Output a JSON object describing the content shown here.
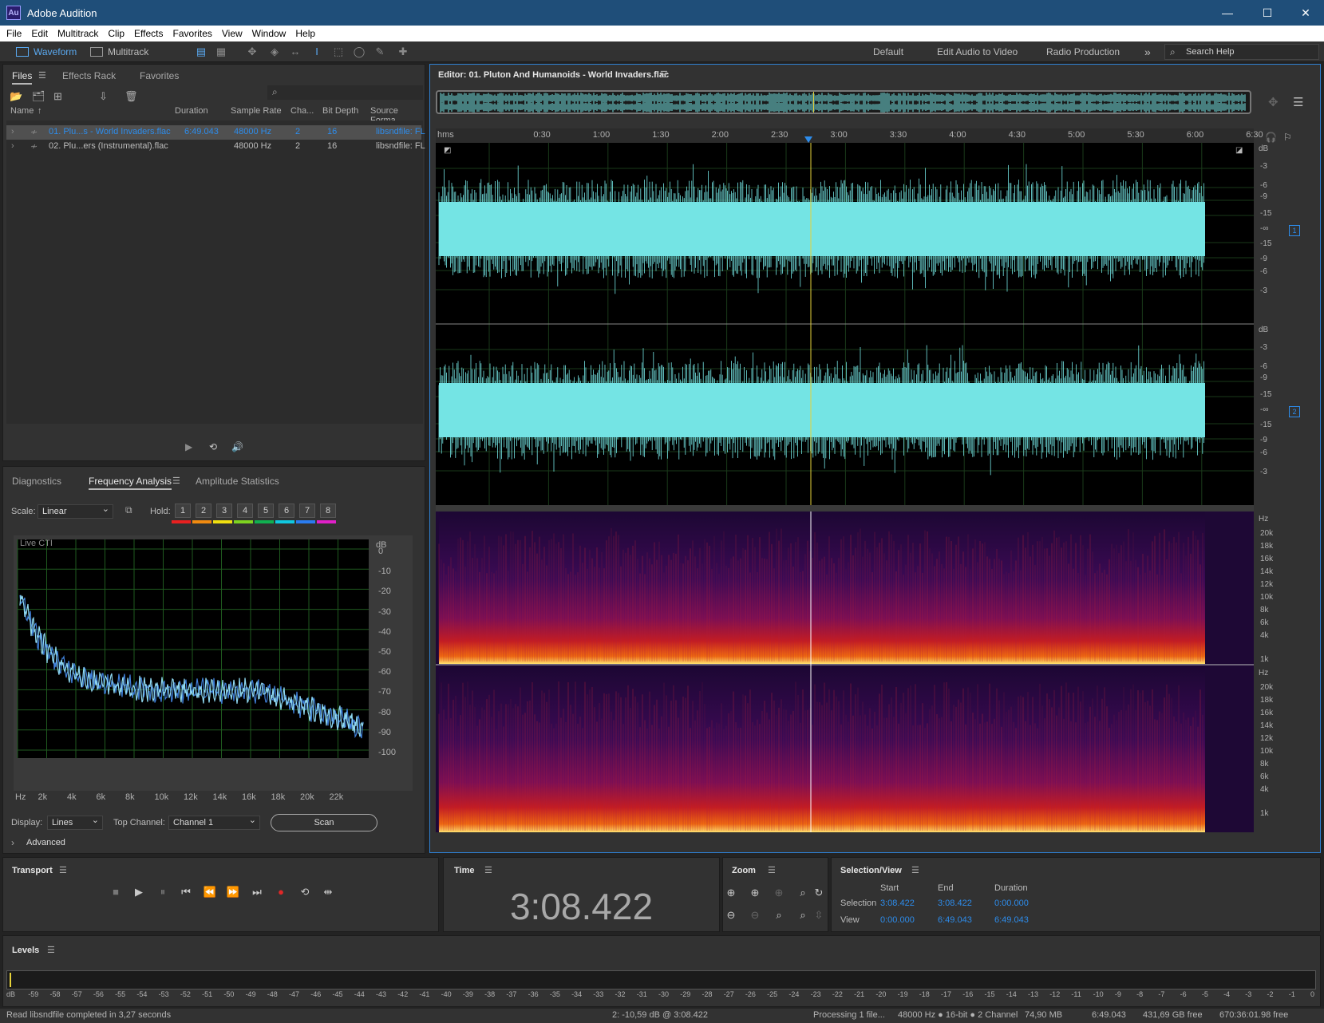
{
  "app": {
    "title": "Adobe Audition",
    "logo_text": "Au"
  },
  "window_controls": {
    "minimize": "—",
    "maximize": "☐",
    "close": "✕"
  },
  "menu": [
    "File",
    "Edit",
    "Multitrack",
    "Clip",
    "Effects",
    "Favorites",
    "View",
    "Window",
    "Help"
  ],
  "toolbar": {
    "waveform": "Waveform",
    "multitrack": "Multitrack",
    "workspaces": [
      "Default",
      "Edit Audio to Video",
      "Radio Production"
    ],
    "more": "»",
    "search_placeholder": "Search Help"
  },
  "files_panel": {
    "tabs": [
      "Files",
      "Effects Rack",
      "Favorites"
    ],
    "columns": [
      "Name",
      "Duration",
      "Sample Rate",
      "Cha...",
      "Bit Depth",
      "Source Forma"
    ],
    "rows": [
      {
        "name": "01. Plu...s - World Invaders.flac",
        "duration": "6:49.043",
        "sample_rate": "48000 Hz",
        "channels": "2",
        "bit_depth": "16",
        "format": "libsndfile: FL"
      },
      {
        "name": "02. Plu...ers (Instrumental).flac",
        "duration": "",
        "sample_rate": "48000 Hz",
        "channels": "2",
        "bit_depth": "16",
        "format": "libsndfile: FL"
      }
    ]
  },
  "analysis_panel": {
    "tabs": [
      "Diagnostics",
      "Frequency Analysis",
      "Amplitude Statistics"
    ],
    "scale_label": "Scale:",
    "scale_value": "Linear",
    "hold_label": "Hold:",
    "holds": [
      "1",
      "2",
      "3",
      "4",
      "5",
      "6",
      "7",
      "8"
    ],
    "hold_colors": [
      "#e82020",
      "#f08a10",
      "#f0e010",
      "#7ed320",
      "#10b050",
      "#10c8e0",
      "#2a7cf0",
      "#e020c8"
    ],
    "live_label": "Live CTI",
    "db_unit": "dB",
    "db_ticks": [
      "0",
      "-10",
      "-20",
      "-30",
      "-40",
      "-50",
      "-60",
      "-70",
      "-80",
      "-90",
      "-100"
    ],
    "hz_ticks": [
      "Hz",
      "2k",
      "4k",
      "6k",
      "8k",
      "10k",
      "12k",
      "14k",
      "16k",
      "18k",
      "20k",
      "22k"
    ],
    "display_label": "Display:",
    "display_value": "Lines",
    "top_channel_label": "Top Channel:",
    "top_channel_value": "Channel 1",
    "scan_label": "Scan",
    "advanced_label": "Advanced"
  },
  "editor": {
    "title": "Editor: 01. Pluton And Humanoids - World Invaders.flac",
    "time_ticks": [
      "hms",
      "0:30",
      "1:00",
      "1:30",
      "2:00",
      "2:30",
      "3:00",
      "3:30",
      "4:00",
      "4:30",
      "5:00",
      "5:30",
      "6:00",
      "6:30"
    ],
    "db_ticks_ch": [
      "dB",
      "-3",
      "-6",
      "-9",
      "-15",
      "-∞",
      "-15",
      "-9",
      "-6",
      "-3"
    ],
    "ch_labels": [
      "1",
      "2"
    ],
    "hz_ticks": [
      "Hz",
      "20k",
      "18k",
      "16k",
      "14k",
      "12k",
      "10k",
      "8k",
      "6k",
      "4k",
      "1k"
    ],
    "wave_color": "#74e4e4",
    "playhead_color": "#e6d23a"
  },
  "transport": {
    "title": "Transport"
  },
  "time_panel": {
    "title": "Time",
    "value": "3:08.422"
  },
  "zoom_panel": {
    "title": "Zoom"
  },
  "selection_panel": {
    "title": "Selection/View",
    "headers": [
      "Start",
      "End",
      "Duration"
    ],
    "selection_label": "Selection",
    "selection": [
      "3:08.422",
      "3:08.422",
      "0:00.000"
    ],
    "view_label": "View",
    "view": [
      "0:00.000",
      "6:49.043",
      "6:49.043"
    ]
  },
  "levels": {
    "title": "Levels",
    "ticks": [
      "dB",
      "-59",
      "-58",
      "-57",
      "-56",
      "-55",
      "-54",
      "-53",
      "-52",
      "-51",
      "-50",
      "-49",
      "-48",
      "-47",
      "-46",
      "-45",
      "-44",
      "-43",
      "-42",
      "-41",
      "-40",
      "-39",
      "-38",
      "-37",
      "-36",
      "-35",
      "-34",
      "-33",
      "-32",
      "-31",
      "-30",
      "-29",
      "-28",
      "-27",
      "-26",
      "-25",
      "-24",
      "-23",
      "-22",
      "-21",
      "-20",
      "-19",
      "-18",
      "-17",
      "-16",
      "-15",
      "-14",
      "-13",
      "-12",
      "-11",
      "-10",
      "-9",
      "-8",
      "-7",
      "-6",
      "-5",
      "-4",
      "-3",
      "-2",
      "-1",
      "0"
    ]
  },
  "status": {
    "left": "Read libsndfile completed in 3,27 seconds",
    "cursor": "2: -10,59 dB @ 3:08.422",
    "processing": "Processing 1 file...",
    "format": "48000 Hz ● 16-bit ● 2 Channel",
    "size": "74,90 MB",
    "duration": "6:49.043",
    "free": "431,69 GB free",
    "free_time": "670:36:01.98 free"
  }
}
